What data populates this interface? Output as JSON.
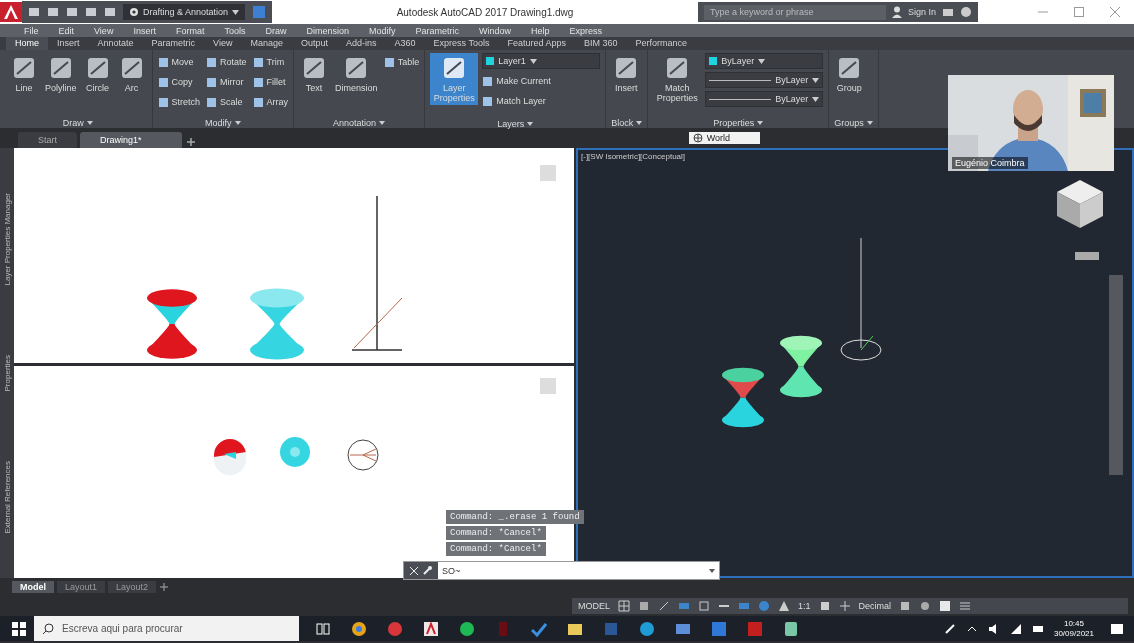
{
  "title_bar": {
    "workspace": "Drafting & Annotation",
    "title": "Autodesk AutoCAD 2017   Drawing1.dwg",
    "search": {
      "placeholder": "Type a keyword or phrase"
    },
    "user": "Sign In"
  },
  "menu_bar": [
    "File",
    "Edit",
    "View",
    "Insert",
    "Format",
    "Tools",
    "Draw",
    "Dimension",
    "Modify",
    "Parametric",
    "Window",
    "Help",
    "Express"
  ],
  "ribbon_tabs": [
    {
      "label": "Home",
      "selected": true
    },
    {
      "label": "Insert",
      "selected": false
    },
    {
      "label": "Annotate",
      "selected": false
    },
    {
      "label": "Parametric",
      "selected": false
    },
    {
      "label": "View",
      "selected": false
    },
    {
      "label": "Manage",
      "selected": false
    },
    {
      "label": "Output",
      "selected": false
    },
    {
      "label": "Add-ins",
      "selected": false
    },
    {
      "label": "A360",
      "selected": false
    },
    {
      "label": "Express Tools",
      "selected": false
    },
    {
      "label": "Featured Apps",
      "selected": false
    },
    {
      "label": "BIM 360",
      "selected": false
    },
    {
      "label": "Performance",
      "selected": false
    }
  ],
  "ribbon_panels": [
    {
      "title": "Draw",
      "tools": [
        {
          "kind": "large",
          "label": "Line"
        },
        {
          "kind": "large",
          "label": "Polyline"
        },
        {
          "kind": "large",
          "label": "Circle"
        },
        {
          "kind": "large",
          "label": "Arc"
        }
      ]
    },
    {
      "title": "Modify",
      "tools": [
        {
          "kind": "small",
          "label": "Move"
        },
        {
          "kind": "small",
          "label": "Copy"
        },
        {
          "kind": "small",
          "label": "Stretch"
        },
        {
          "kind": "small",
          "label": "Rotate"
        },
        {
          "kind": "small",
          "label": "Mirror"
        },
        {
          "kind": "small",
          "label": "Scale"
        },
        {
          "kind": "small",
          "label": "Trim"
        },
        {
          "kind": "small",
          "label": "Fillet"
        },
        {
          "kind": "small",
          "label": "Array"
        }
      ]
    },
    {
      "title": "Annotation",
      "tools": [
        {
          "kind": "large",
          "label": "Text"
        },
        {
          "kind": "large",
          "label": "Dimension"
        },
        {
          "kind": "small",
          "label": "Table"
        }
      ]
    },
    {
      "title": "Layers",
      "tools": [
        {
          "kind": "large",
          "label": "Layer Properties",
          "selected": true
        },
        {
          "kind": "dropdown",
          "label": "Layer1"
        },
        {
          "kind": "small",
          "label": "Make Current"
        },
        {
          "kind": "small",
          "label": "Match Layer"
        }
      ]
    },
    {
      "title": "Block",
      "tools": [
        {
          "kind": "large",
          "label": "Insert"
        }
      ]
    },
    {
      "title": "Properties",
      "tools": [
        {
          "kind": "large",
          "label": "Match Properties"
        },
        {
          "kind": "dropdown",
          "label": "ByLayer"
        },
        {
          "kind": "dropdown",
          "label": "ByLayer"
        },
        {
          "kind": "dropdown",
          "label": "ByLayer"
        }
      ]
    },
    {
      "title": "Groups",
      "tools": [
        {
          "kind": "large",
          "label": "Group"
        }
      ]
    }
  ],
  "document_tabs": [
    {
      "label": "Start",
      "selected": false
    },
    {
      "label": "Drawing1*",
      "selected": true
    }
  ],
  "ucs": "World",
  "webcam": {
    "name": "Eugénio Coimbra"
  },
  "palettes": [
    "Layer Properties Manager",
    "Properties",
    "External References"
  ],
  "viewport_label": "[-][SW Isometric][Conceptual]",
  "command_history": [
    "Command:  _.erase 1 found",
    "Command: *Cancel*",
    "Command: *Cancel*"
  ],
  "command_line": {
    "value": "SO~"
  },
  "layout_tabs": [
    {
      "label": "Model",
      "selected": true
    },
    {
      "label": "Layout1",
      "selected": false
    },
    {
      "label": "Layout2",
      "selected": false
    }
  ],
  "status_bar": {
    "mode": "MODEL",
    "scale": "1:1",
    "units": "Decimal"
  },
  "taskbar": {
    "search": {
      "placeholder": "Escreva aqui para procurar"
    },
    "time": "10:45",
    "date": "30/09/2021"
  }
}
